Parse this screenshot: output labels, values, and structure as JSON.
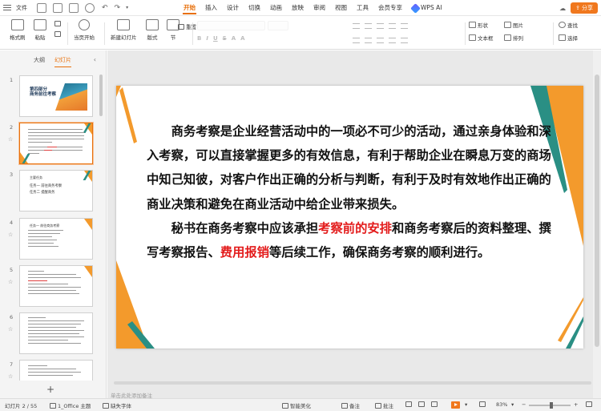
{
  "titlebar": {
    "file_label": "文件",
    "tabs": [
      "开始",
      "插入",
      "设计",
      "切换",
      "动画",
      "放映",
      "审阅",
      "视图",
      "工具",
      "会员专享"
    ],
    "active_tab": "开始",
    "wps_ai_label": "WPS AI",
    "share_label": "分享",
    "accent_color": "#e8700b"
  },
  "toolbar": {
    "format_painter": "格式刷",
    "paste": "粘贴",
    "play_from_current": "当页开始",
    "new_slide": "新建幻灯片",
    "layout": "版式",
    "section": "节",
    "reset": "重置",
    "shape": "形状",
    "picture": "图片",
    "find": "查找",
    "textbox": "文本框",
    "arrange": "排列",
    "select": "选择"
  },
  "left_panel": {
    "tab_outline": "大纲",
    "tab_slides": "幻灯片",
    "slide_numbers": [
      "1",
      "2",
      "3",
      "4",
      "5",
      "6",
      "7"
    ],
    "thumb1_title_line1": "第四部分",
    "thumb1_title_line2": "商务前往考察",
    "thumb3_heading": "主要任务",
    "thumb3_item1": "任务一  前往商务考察",
    "thumb3_item2": "任务二  提醒商务",
    "thumb4_heading": "任务一   前往商务考察",
    "add_slide": "+"
  },
  "slide": {
    "para1": "商务考察是企业经营活动中的一项必不可少的活动，通过亲身体验和深入考察，可以直接掌握更多的有效信息，有利于帮助企业在瞬息万变的商场中知己知彼，对客户作出正确的分析与判断，有利于及时有效地作出正确的商业决策和避免在商业活动中给企业带来损失。",
    "para2_a": "秘书在商务考察中应该承担",
    "para2_hl1": "考察前的安排",
    "para2_b": "和商务考察后的资料整理、撰写考察报告、",
    "para2_hl2": "费用报销",
    "para2_c": "等后续工作，确保商务考察的顺利进行。",
    "highlight_color": "#e31b1b",
    "deco_orange": "#f39a2c",
    "deco_teal": "#2a8f84"
  },
  "notes_placeholder": "单击此处添加备注",
  "statusbar": {
    "slide_pos": "幻灯片 2 / 55",
    "theme": "1_Office 主题",
    "missing_font": "缺失字体",
    "smart_beautify": "智能美化",
    "notes": "备注",
    "comments": "批注",
    "zoom": "83%"
  }
}
